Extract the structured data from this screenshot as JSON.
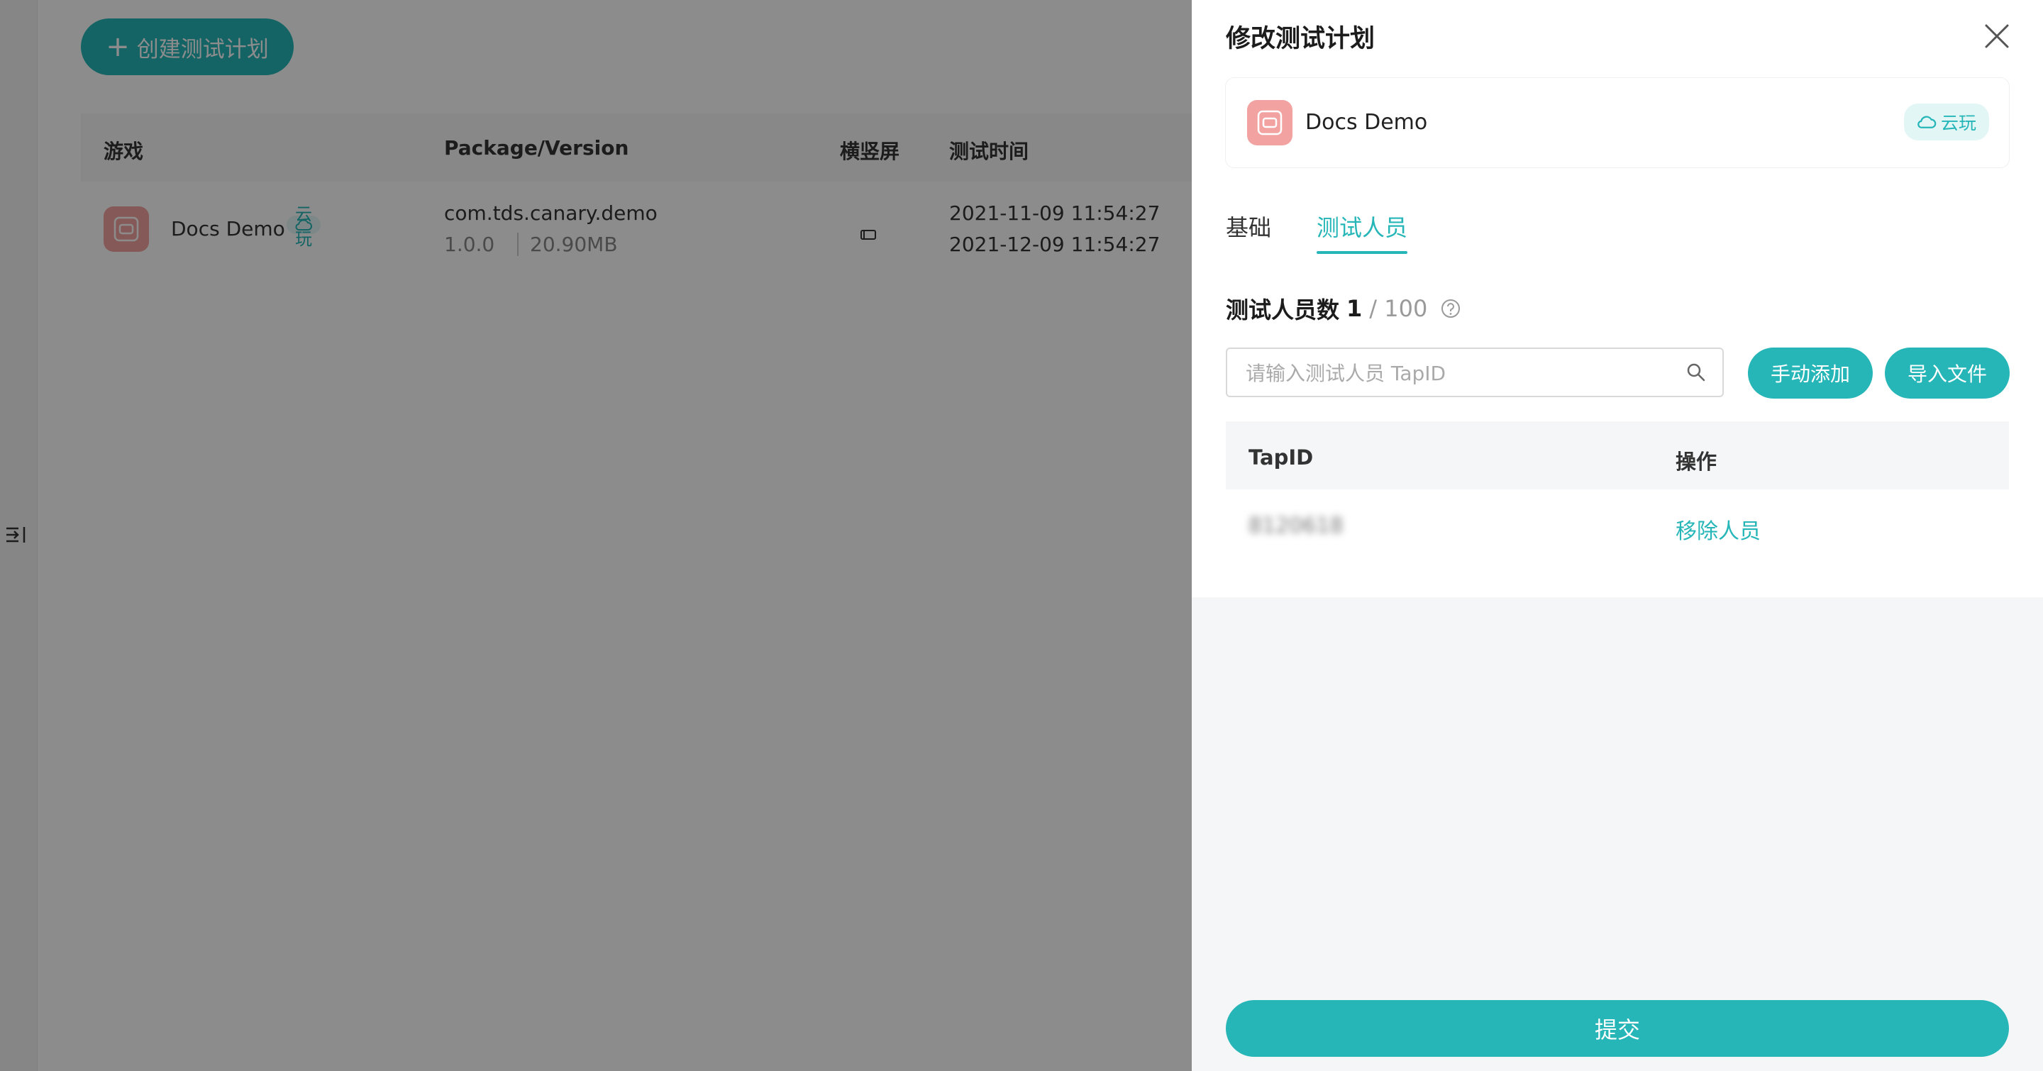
{
  "background": {
    "create_button_label": "创建测试计划",
    "columns": [
      "游戏",
      "Package/Version",
      "横竖屏",
      "测试时间"
    ],
    "rows": [
      {
        "game_name": "Docs Demo",
        "cloud_tag": "云玩",
        "package": "com.tds.canary.demo",
        "version": "1.0.0",
        "size": "20.90MB",
        "start_time": "2021-11-09 11:54:27",
        "end_time": "2021-12-09 11:54:27"
      }
    ]
  },
  "drawer": {
    "title": "修改测试计划",
    "game_card": {
      "name": "Docs Demo",
      "cloud_tag": "云玩"
    },
    "tabs": [
      {
        "label": "基础",
        "active": false
      },
      {
        "label": "测试人员",
        "active": true
      }
    ],
    "tester_count": {
      "label": "测试人员数",
      "current": "1",
      "max": "/ 100"
    },
    "search": {
      "placeholder": "请输入测试人员 TapID",
      "value": ""
    },
    "buttons": {
      "manual_add": "手动添加",
      "import_file": "导入文件",
      "submit": "提交"
    },
    "table": {
      "columns": [
        "TapID",
        "操作"
      ],
      "rows": [
        {
          "tapid": "8120618",
          "action": "移除人员"
        }
      ]
    }
  },
  "colors": {
    "accent": "#26b6b8",
    "game_icon": "#f2a3a1",
    "overlay": "rgba(0,0,0,0.45)"
  }
}
